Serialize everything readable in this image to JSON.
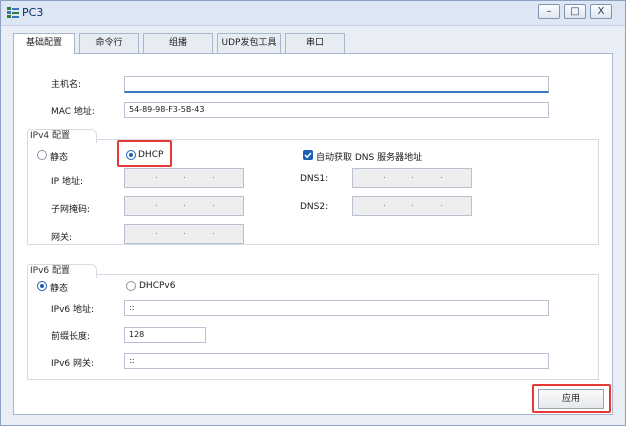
{
  "window": {
    "title": "PC3",
    "controls": {
      "minimize": "–",
      "maximize": "□",
      "close": "X"
    }
  },
  "tabs": [
    "基础配置",
    "命令行",
    "组播",
    "UDP发包工具",
    "串口"
  ],
  "basic": {
    "hostname_label": "主机名:",
    "hostname_value": "",
    "mac_label": "MAC 地址:",
    "mac_value": "54-89-98-F3-5B-43"
  },
  "ipv4": {
    "group_label": "IPv4 配置",
    "static_label": "静态",
    "dhcp_label": "DHCP",
    "mode": "DHCP",
    "auto_dns_label": "自动获取 DNS 服务器地址",
    "auto_dns_checked": true,
    "ip_label": "IP 地址:",
    "mask_label": "子网掩码:",
    "gateway_label": "网关:",
    "dns1_label": "DNS1:",
    "dns2_label": "DNS2:"
  },
  "ipv6": {
    "group_label": "IPv6 配置",
    "static_label": "静态",
    "dhcp_label": "DHCPv6",
    "mode": "静态",
    "addr_label": "IPv6 地址:",
    "addr_value": "::",
    "prefix_label": "前缀长度:",
    "prefix_value": "128",
    "gateway_label": "IPv6 网关:",
    "gateway_value": "::"
  },
  "apply_label": "应用",
  "colors": {
    "highlight": "#e53935",
    "accent": "#1c5fb4"
  }
}
